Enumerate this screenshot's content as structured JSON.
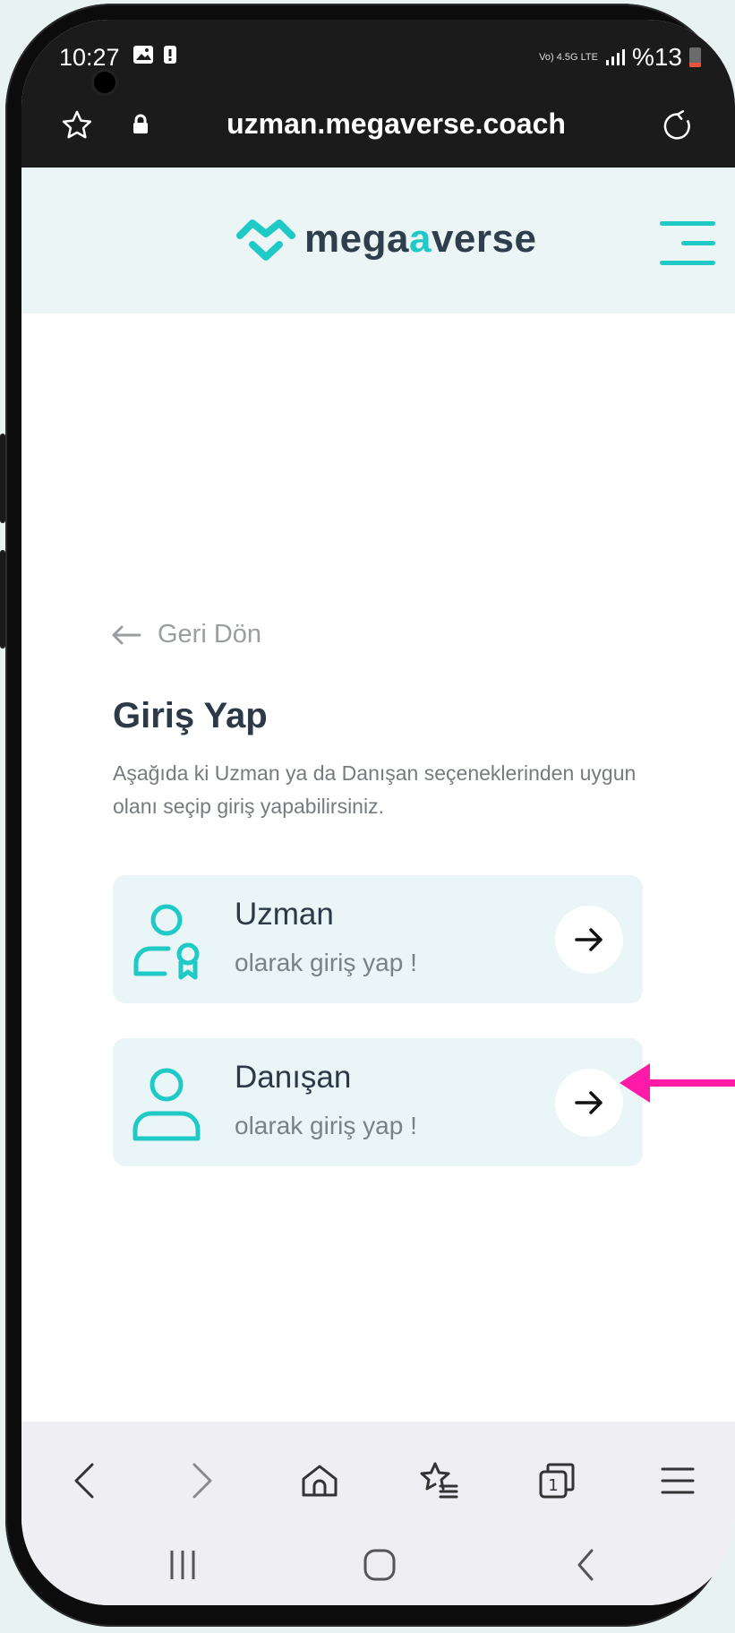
{
  "status_bar": {
    "time": "10:27",
    "network": "Vo) 4.5G LTE",
    "battery_text": "%13"
  },
  "browser": {
    "url": "uzman.megaverse.coach",
    "icons": {
      "bookmark": "star-icon",
      "secure": "lock-icon",
      "reload": "reload-icon",
      "back": "chevron-left-icon",
      "forward": "chevron-right-icon",
      "home": "home-icon",
      "bookmarks": "star-list-icon",
      "tabs": "tabs-icon",
      "menu": "menu-icon"
    },
    "tab_count": "1"
  },
  "site": {
    "logo_prefix": "mega",
    "logo_accent": "a",
    "logo_suffix": "verse",
    "brand_color": "#1fc9c6",
    "text_color": "#2c3a48"
  },
  "page": {
    "back_label": "Geri Dön",
    "title": "Giriş Yap",
    "description": "Aşağıda ki Uzman ya da Danışan seçeneklerinden uygun olanı seçip giriş yapabilirsiniz.",
    "options": [
      {
        "title": "Uzman",
        "subtitle": "olarak giriş yap !",
        "icon": "expert-user-icon"
      },
      {
        "title": "Danışan",
        "subtitle": "olarak giriş yap !",
        "icon": "user-icon"
      }
    ]
  },
  "annotation": {
    "color": "#ff1aa8",
    "icon": "pointer-arrow-icon"
  }
}
